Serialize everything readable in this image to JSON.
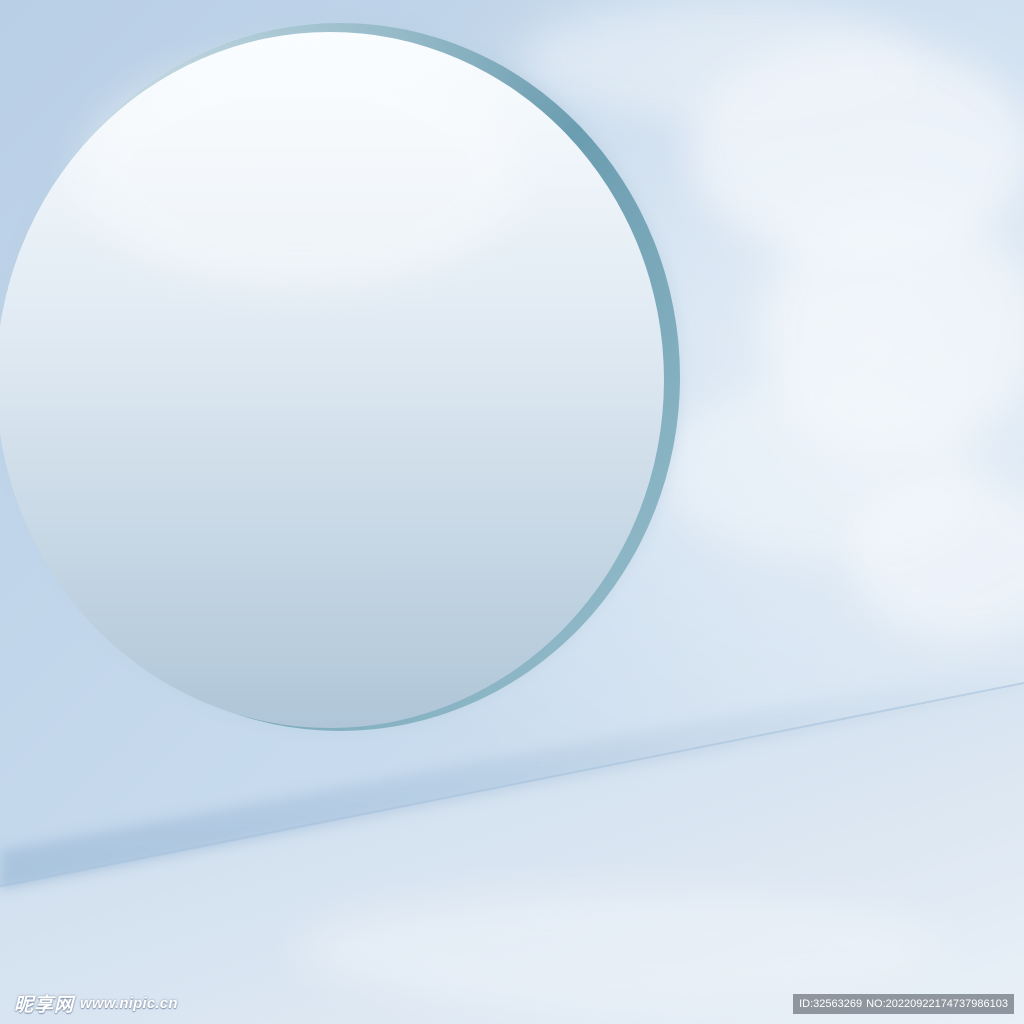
{
  "scene": {
    "description_colors": {
      "wall": "#c5d8ec",
      "floor": "#d7e4f1",
      "circle_fill_top": "#f7fbfe",
      "circle_fill_bottom": "#b3cadb",
      "circle_rim": "#6f9fb1"
    }
  },
  "watermark": {
    "logo_text": "昵享网",
    "url": "www.nipic.cn",
    "id_label": "ID:32563269",
    "no_label": "NO:20220922174737986103"
  }
}
